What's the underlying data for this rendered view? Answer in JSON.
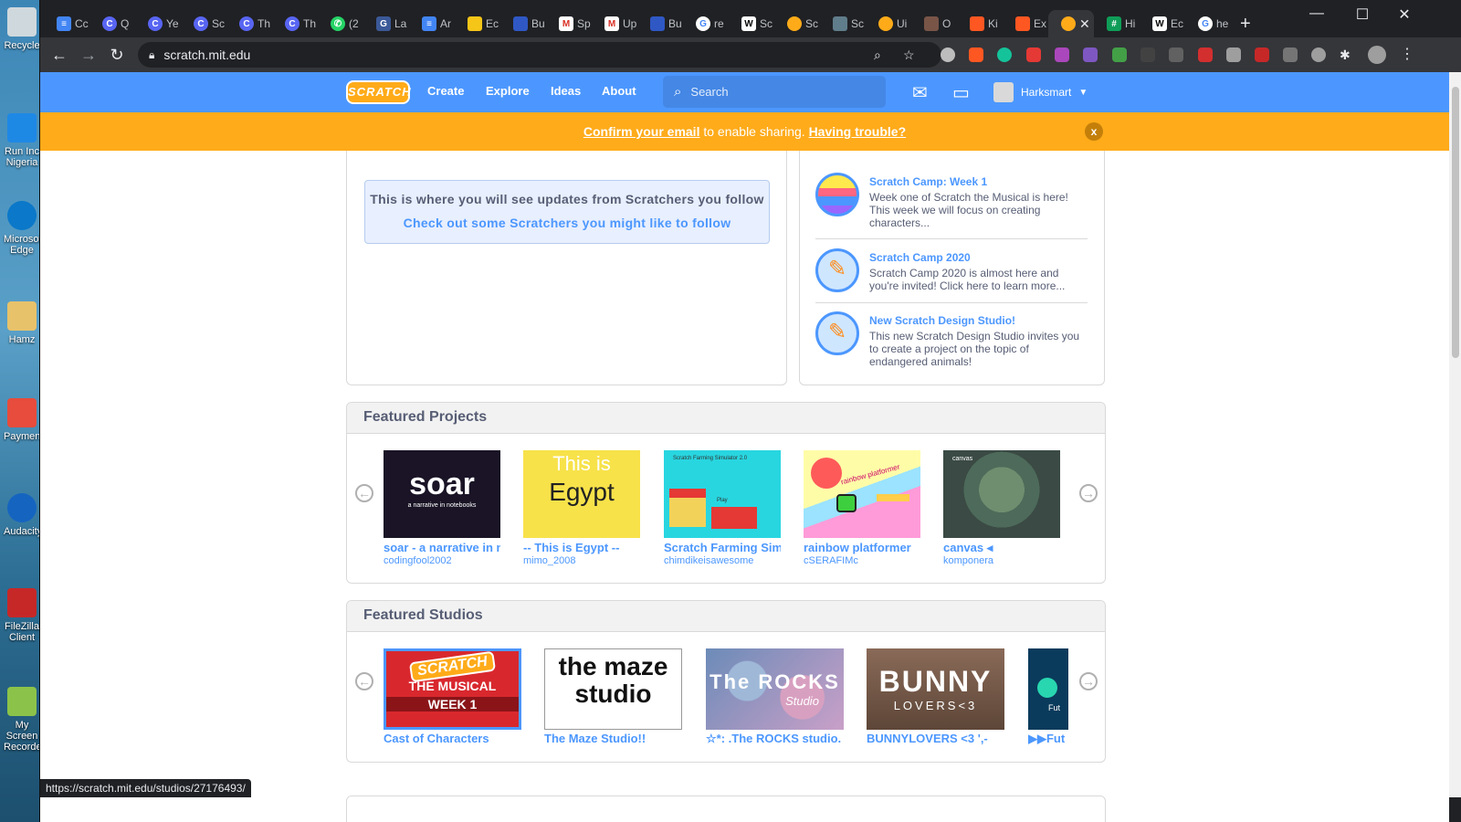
{
  "desktop": {
    "icons": [
      "Recycle",
      "Run Inc Nigeria",
      "Microsoft Edge",
      "Hamz",
      "Payment",
      "Audacity",
      "FileZilla Client",
      "My Screen Recorder"
    ]
  },
  "browser": {
    "tabs": [
      "Cc",
      "Q",
      "Ye",
      "Sc",
      "Th",
      "Th",
      "(2",
      "La",
      "Ar",
      "Ec",
      "Bu",
      "Sp",
      "Up",
      "Bu",
      "re",
      "Sc",
      "Sc",
      "Sc",
      "Ui",
      "O",
      "Ki",
      "Ex",
      "",
      "Hi",
      "Ec",
      "he"
    ],
    "url": "scratch.mit.edu",
    "status_url": "https://scratch.mit.edu/studios/27176493/"
  },
  "nav": {
    "logo": "SCRATCH",
    "create": "Create",
    "explore": "Explore",
    "ideas": "Ideas",
    "about": "About",
    "search_placeholder": "Search",
    "username": "Harksmart"
  },
  "banner": {
    "confirm_link": "Confirm your email",
    "middle": " to enable sharing. ",
    "trouble_link": "Having trouble?",
    "close": "x"
  },
  "activity": {
    "line1": "This is where you will see updates from Scratchers you follow",
    "line2": "Check out some Scratchers you might like to follow"
  },
  "news": [
    {
      "title": "Scratch Camp: Week 1",
      "body": "Week one of Scratch the Musical is here! This week we will focus on creating characters..."
    },
    {
      "title": "Scratch Camp 2020",
      "body": "Scratch Camp 2020 is almost here and you're invited! Click here to learn more..."
    },
    {
      "title": "New Scratch Design Studio!",
      "body": "This new Scratch Design Studio invites you to create a project on the topic of endangered animals!"
    }
  ],
  "featured_projects": {
    "heading": "Featured Projects",
    "items": [
      {
        "title": "soar - a narrative in n",
        "author": "codingfool2002",
        "thumb_text": "soar",
        "thumb_sub": "a narrative in notebooks"
      },
      {
        "title": "-- This is Egypt --",
        "author": "mimo_2008",
        "thumb_text": "This is",
        "thumb_sub": "Egypt"
      },
      {
        "title": "Scratch Farming Sim",
        "author": "chimdikeisawesome",
        "thumb_text": "Scratch Farming Simulator 2.0",
        "thumb_sub": "Play"
      },
      {
        "title": "rainbow platformer",
        "author": "cSERAFIMc",
        "thumb_text": "rainbow platformer",
        "thumb_sub": ""
      },
      {
        "title": "canvas ◂",
        "author": "komponera",
        "thumb_text": "canvas",
        "thumb_sub": ""
      }
    ]
  },
  "featured_studios": {
    "heading": "Featured Studios",
    "items": [
      {
        "title": "Cast of Characters",
        "thumb_text": "SCRATCH",
        "thumb_sub": "THE MUSICAL",
        "thumb_sub2": "WEEK 1"
      },
      {
        "title": "The Maze Studio!!",
        "thumb_text": "the maze",
        "thumb_sub": "studio"
      },
      {
        "title": "☆*: .The ROCKS studio.",
        "thumb_text": "The ROCKS",
        "thumb_sub": "Studio"
      },
      {
        "title": "BUNNYLOVERS <3 ',-",
        "thumb_text": "BUNNY",
        "thumb_sub": "LOVERS<3"
      },
      {
        "title": "▶▶Fut",
        "thumb_text": "Fut",
        "thumb_sub": ""
      }
    ]
  },
  "colors": {
    "scratch_blue": "#4c97ff",
    "banner_orange": "#ffab1a"
  }
}
